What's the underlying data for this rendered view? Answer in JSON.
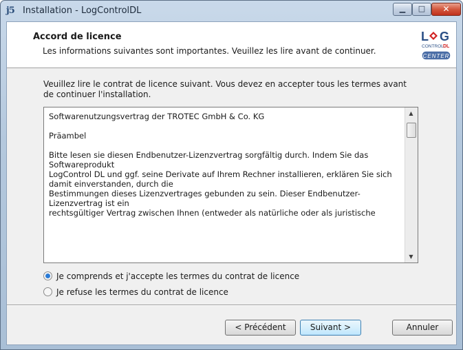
{
  "window": {
    "title": "Installation - LogControlDL",
    "minimize_glyph": "▁",
    "maximize_glyph": "□",
    "close_glyph": "✕",
    "app_icon": "installer-icon"
  },
  "header": {
    "title": "Accord de licence",
    "subtitle": "Les informations suivantes sont importantes. Veuillez les lire avant de continuer.",
    "logo": {
      "line1": "L",
      "line1b": "G",
      "line2": "CONTROL",
      "line2b": "DL",
      "badge": "CENTER"
    }
  },
  "content": {
    "intro": "Veuillez lire le contrat de licence suivant. Vous devez en accepter tous les termes avant de continuer l'installation.",
    "license_lines": {
      "l1": "Softwarenutzungsvertrag der TROTEC GmbH & Co. KG",
      "l2": "Präambel",
      "l3": "Bitte lesen sie diesen Endbenutzer-Lizenzvertrag sorgfältig durch. Indem Sie das Softwareprodukt",
      "l4": "LogControl DL und ggf. seine Derivate auf Ihrem Rechner installieren, erklären Sie sich damit einverstanden, durch die",
      "l5": "Bestimmungen dieses Lizenzvertrages gebunden zu sein. Dieser Endbenutzer-Lizenzvertrag ist ein",
      "l6": "rechtsgültiger Vertrag zwischen Ihnen (entweder als natürliche oder als juristische"
    },
    "radio_accept": "Je comprends et j'accepte les termes du contrat de licence",
    "radio_refuse": "Je refuse les termes du contrat de licence",
    "accept_selected": true
  },
  "buttons": {
    "previous": "< Précédent",
    "next": "Suivant >",
    "cancel": "Annuler"
  },
  "colors": {
    "logo_red": "#d12020",
    "logo_blue": "#2b4f86",
    "radio_selected": "#2a7bd6"
  }
}
